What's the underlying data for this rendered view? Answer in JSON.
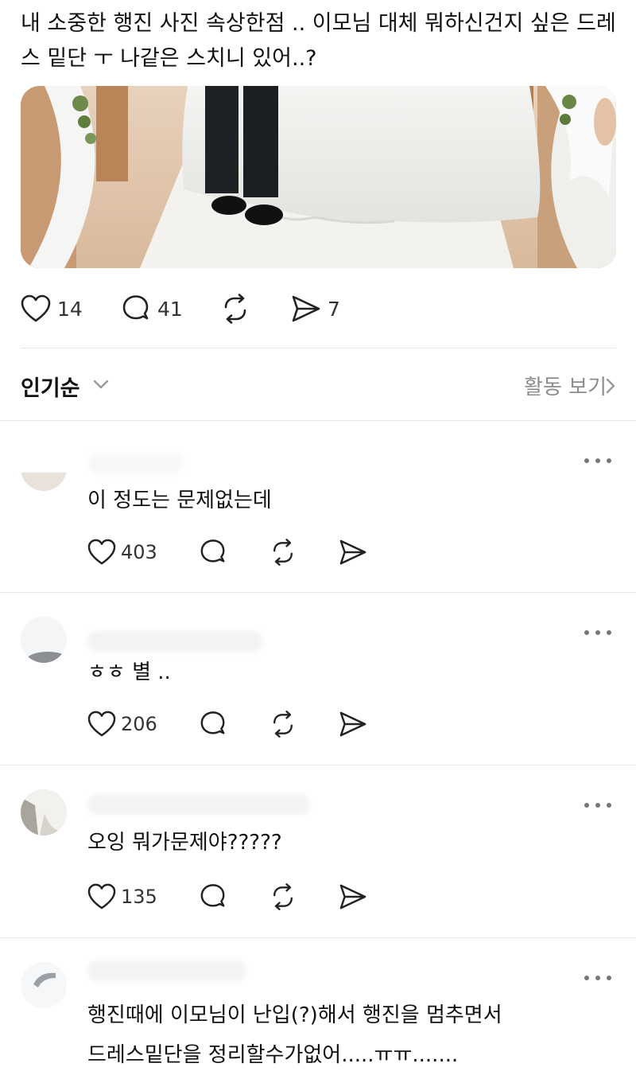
{
  "post": {
    "text": "내 소중한 행진 사진 속상한점 .. 이모님 대체 뭐하신건지 싶은 드레스 밑단 ㅜ 나같은 스치니 있어..?",
    "likes": "14",
    "comments": "41",
    "shares": "7"
  },
  "sort": {
    "label": "인기순",
    "activity_label": "활동 보기"
  },
  "comments": [
    {
      "text": "이 정도는 문제없는데",
      "likes": "403"
    },
    {
      "text": "ㅎㅎ 별 ..",
      "likes": "206"
    },
    {
      "text": "오잉 뭐가문제야?????",
      "likes": "135"
    },
    {
      "text": "행진때에 이모님이 난입(?)해서 행진을 멈추면서\n드레스밑단을 정리할수가없어.....ㅠㅠ......."
    }
  ],
  "icons": {
    "like": "heart-icon",
    "comment": "comment-bubble-icon",
    "repost": "repost-icon",
    "share": "send-icon",
    "more": "more-dots-icon",
    "sort_dropdown": "chevron-down-icon",
    "activity": "chevron-right-icon"
  },
  "colors": {
    "text": "#111111",
    "muted": "#8c8c8c",
    "divider": "#e6e6e6"
  }
}
